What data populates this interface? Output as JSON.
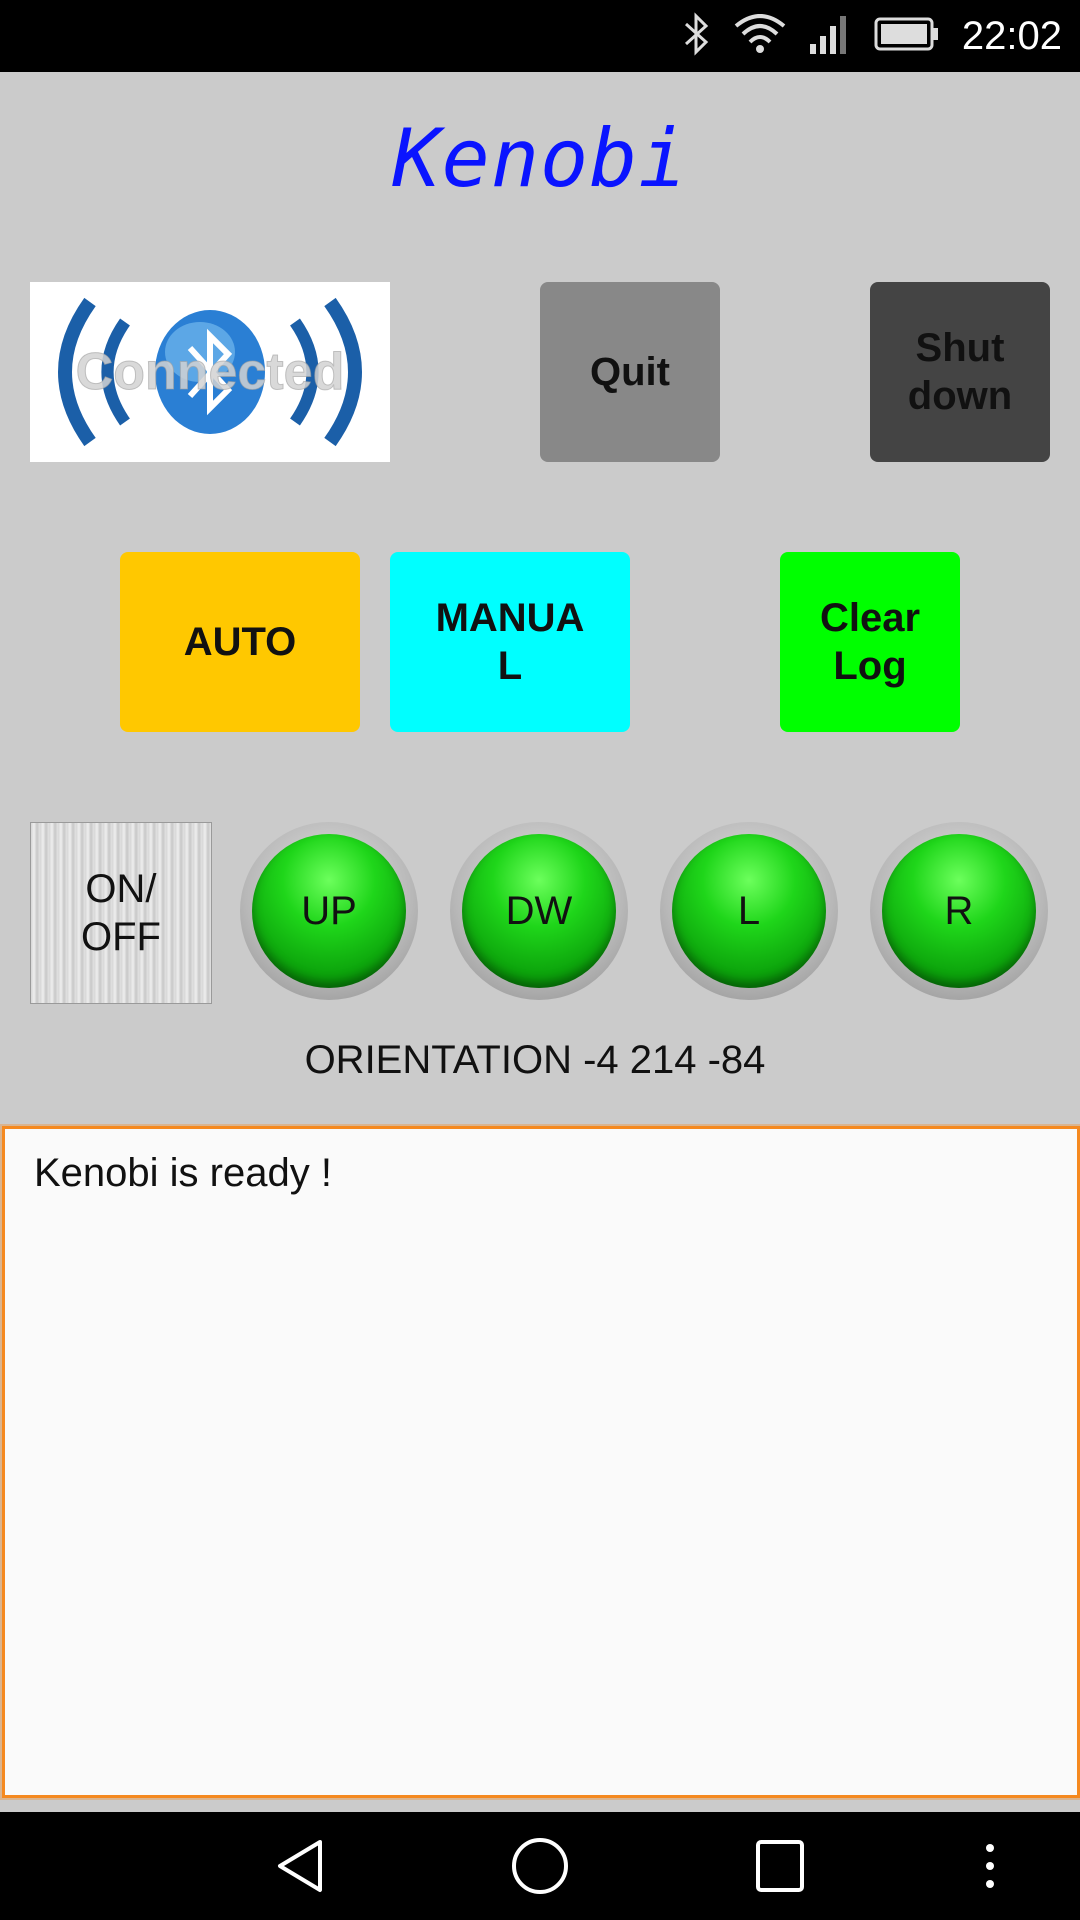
{
  "status_bar": {
    "time": "22:02",
    "icons": [
      "bluetooth-icon",
      "wifi-icon",
      "signal-icon",
      "battery-icon"
    ]
  },
  "app": {
    "title": "Kenobi",
    "title_color": "#0a14ff"
  },
  "bluetooth_status": {
    "label": "Connected",
    "icon": "bluetooth-icon"
  },
  "buttons": {
    "quit": "Quit",
    "shutdown": "Shut\ndown",
    "auto": "AUTO",
    "manual": "MANUA\nL",
    "clear_log": "Clear\nLog",
    "on_off": "ON/\nOFF"
  },
  "direction_buttons": {
    "up": "UP",
    "down": "DW",
    "left": "L",
    "right": "R"
  },
  "orientation": "ORIENTATION -4 214 -84",
  "log": {
    "text": "Kenobi is ready !"
  },
  "colors": {
    "background": "#cbcbcb",
    "quit": "#888888",
    "shutdown": "#444444",
    "auto": "#ffc800",
    "manual": "#00ffff",
    "clear_log": "#00ff00",
    "log_border": "#f5891f",
    "direction_button": "#1fd61a"
  },
  "nav_bar": {
    "icons": [
      "back-icon",
      "home-icon",
      "recents-icon",
      "more-icon"
    ]
  }
}
